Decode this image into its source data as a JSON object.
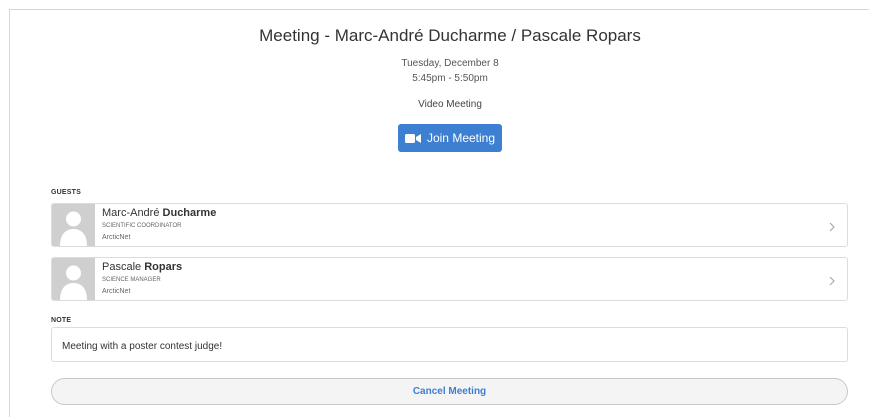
{
  "meeting": {
    "title": "Meeting - Marc-André Ducharme / Pascale Ropars",
    "date": "Tuesday, December 8",
    "time": "5:45pm - 5:50pm",
    "type": "Video Meeting",
    "join_label": "Join Meeting"
  },
  "guests": {
    "label": "GUESTS",
    "items": [
      {
        "first": "Marc-André",
        "last": "Ducharme",
        "role": "SCIENTIFIC COORDINATOR",
        "org": "ArcticNet"
      },
      {
        "first": "Pascale",
        "last": "Ropars",
        "role": "SCIENCE MANAGER",
        "org": "ArcticNet"
      }
    ]
  },
  "note": {
    "label": "NOTE",
    "text": "Meeting with a poster contest judge!"
  },
  "cancel_label": "Cancel Meeting",
  "colors": {
    "accent": "#3d7fd0",
    "avatar_bg": "#cfcfcf"
  },
  "icons": {
    "join": "video-camera-icon",
    "avatar": "user-silhouette-icon",
    "row_action": "chevron-right-icon"
  }
}
